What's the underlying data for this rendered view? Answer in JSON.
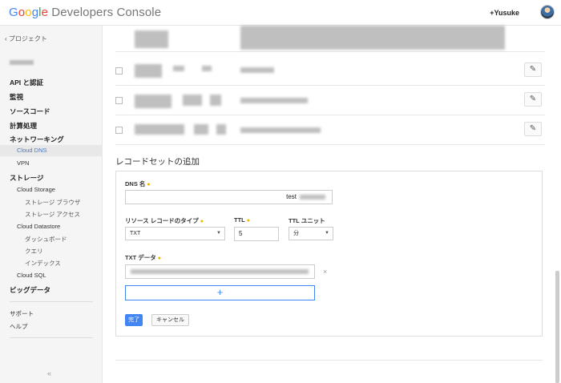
{
  "header": {
    "logo_letters": [
      "G",
      "o",
      "o",
      "g",
      "l",
      "e"
    ],
    "logo_rest": " Developers Console",
    "user": "+Yusuke"
  },
  "sidebar": {
    "back": "‹ プロジェクト",
    "items": {
      "api": "API と認証",
      "monitoring": "監視",
      "source": "ソースコード",
      "compute": "計算処理",
      "networking": "ネットワーキング",
      "cloud_dns": "Cloud DNS",
      "vpn": "VPN",
      "storage": "ストレージ",
      "cloud_storage": "Cloud Storage",
      "storage_browser": "ストレージ ブラウザ",
      "storage_access": "ストレージ アクセス",
      "cloud_datastore": "Cloud Datastore",
      "dashboard": "ダッシュボード",
      "query": "クエリ",
      "index": "インデックス",
      "cloud_sql": "Cloud SQL",
      "bigdata": "ビッグデータ",
      "support": "サポート",
      "help": "ヘルプ"
    },
    "collapse": "«"
  },
  "form": {
    "title": "レコードセットの追加",
    "dns_label": "DNS 名",
    "dns_suffix": "test",
    "type_label": "リソース レコードのタイプ",
    "type_value": "TXT",
    "ttl_label": "TTL",
    "ttl_value": "5",
    "ttl_unit_label": "TTL ユニット",
    "ttl_unit_value": "分",
    "txt_label": "TXT データ",
    "add_symbol": "+",
    "remove_symbol": "×",
    "done": "完了",
    "cancel": "キャンセル"
  },
  "icons": {
    "edit": "pencil-icon",
    "required": "required-dot-icon",
    "dropdown": "caret-down-icon"
  }
}
